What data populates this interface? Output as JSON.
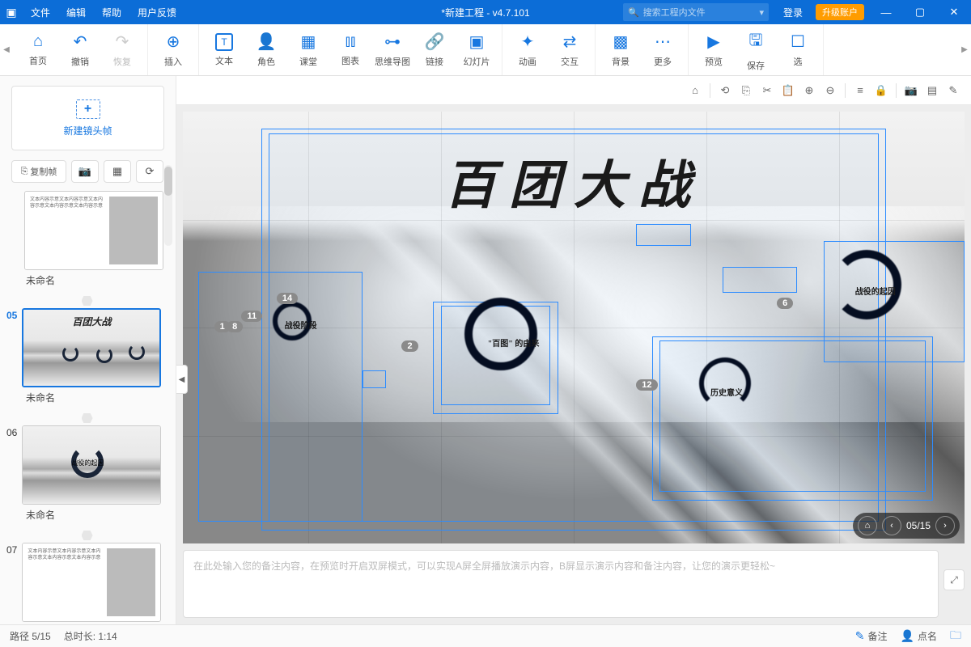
{
  "titlebar": {
    "menus": [
      "文件",
      "编辑",
      "帮助",
      "用户反馈"
    ],
    "title": "*新建工程 - v4.7.101",
    "search_placeholder": "搜索工程内文件",
    "login": "登录",
    "upgrade": "升级账户"
  },
  "ribbon": {
    "groups": [
      {
        "items": [
          {
            "icon": "⌂",
            "label": "首页"
          },
          {
            "icon": "↶",
            "label": "撤销"
          },
          {
            "icon": "↷",
            "label": "恢复",
            "disabled": true
          }
        ]
      },
      {
        "items": [
          {
            "icon": "⊕",
            "label": "插入"
          }
        ]
      },
      {
        "items": [
          {
            "icon": "T",
            "label": "文本",
            "box": true
          },
          {
            "icon": "👤",
            "label": "角色"
          },
          {
            "icon": "▦",
            "label": "课堂"
          },
          {
            "icon": "⫾⫾",
            "label": "图表"
          },
          {
            "icon": "⊶",
            "label": "思维导图"
          },
          {
            "icon": "🔗",
            "label": "链接"
          },
          {
            "icon": "▣",
            "label": "幻灯片"
          }
        ]
      },
      {
        "items": [
          {
            "icon": "✦",
            "label": "动画"
          },
          {
            "icon": "⇄",
            "label": "交互"
          }
        ]
      },
      {
        "items": [
          {
            "icon": "▩",
            "label": "背景"
          },
          {
            "icon": "⋯",
            "label": "更多"
          }
        ]
      },
      {
        "items": [
          {
            "icon": "▶",
            "label": "预览"
          },
          {
            "icon": "🖫",
            "label": "保存"
          },
          {
            "icon": "☐",
            "label": "选"
          }
        ]
      }
    ]
  },
  "sidebar": {
    "new_frame_label": "新建镜头帧",
    "copy_frame_label": "复制帧",
    "framesu_label": "未命名",
    "frames": [
      {
        "num": "",
        "label": "未命名",
        "type": "content"
      },
      {
        "num": "05",
        "label": "未命名",
        "type": "mountain_main",
        "active": true
      },
      {
        "num": "06",
        "label": "未命名",
        "type": "mountain_ring"
      },
      {
        "num": "07",
        "label": "",
        "type": "content"
      }
    ]
  },
  "canvas": {
    "main_title": "百团大战",
    "ring_labels": {
      "r1": "战役阶段",
      "r2": "\"百图\" 的由来",
      "r3": "历史意义",
      "r4": "战役的起因"
    },
    "badges": [
      "14",
      "11",
      "1",
      "8",
      "2",
      "12",
      "6"
    ],
    "nav": {
      "counter": "05/15"
    }
  },
  "notes": {
    "placeholder": "在此处输入您的备注内容，在预览时开启双屏模式，可以实现A屏全屏播放演示内容，B屏显示演示内容和备注内容，让您的演示更轻松~"
  },
  "statusbar": {
    "path": "路径 5/15",
    "duration": "总时长: 1:14",
    "notes_btn": "备注",
    "click_btn": "点名"
  }
}
